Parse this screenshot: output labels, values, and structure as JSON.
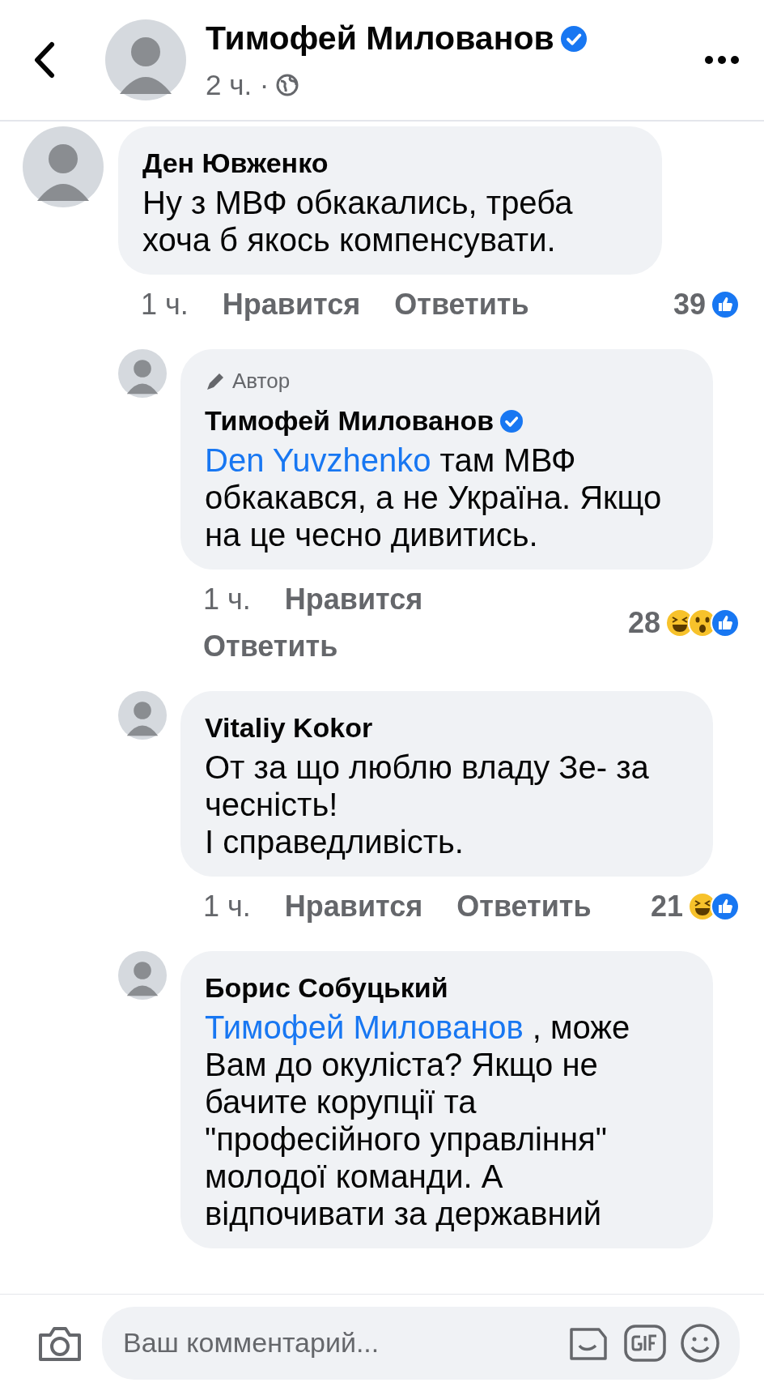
{
  "header": {
    "author": "Тимофей Милованов",
    "verified": true,
    "time": "2 ч. ·"
  },
  "comments": [
    {
      "author": "Ден Ювженко",
      "verified": false,
      "text": "Ну з МВФ обкакались, треба хоча б якось компенсувати.",
      "time": "1 ч.",
      "like": "Нравится",
      "reply": "Ответить",
      "count": "39",
      "reactions": [
        {
          "kind": "like"
        }
      ],
      "children": [
        {
          "badge": "Автор",
          "author": "Тимофей Милованов",
          "verified": true,
          "mention": "Den Yuvzhenko",
          "text": " там МВФ обкакався, а не Україна. Якщо на це чесно дивитись.",
          "time": "1 ч.",
          "like": "Нравится",
          "reply": "Ответить",
          "count": "28",
          "reactions": [
            {
              "kind": "haha"
            },
            {
              "kind": "wow"
            },
            {
              "kind": "like"
            }
          ]
        },
        {
          "author": "Vitaliy Kokor",
          "verified": false,
          "text": "От за що люблю владу Зе- за чесність!\nІ справедливість.",
          "time": "1 ч.",
          "like": "Нравится",
          "reply": "Ответить",
          "count": "21",
          "reactions": [
            {
              "kind": "haha"
            },
            {
              "kind": "like"
            }
          ]
        },
        {
          "author": "Борис Собуцький",
          "verified": false,
          "mention": "Тимофей Милованов",
          "text": " , може Вам до окуліста? Якщо не бачите корупції та \"професійного управління\" молодої команди. А відпочивати за державний"
        }
      ]
    }
  ],
  "composer": {
    "placeholder": "Ваш комментарий..."
  }
}
